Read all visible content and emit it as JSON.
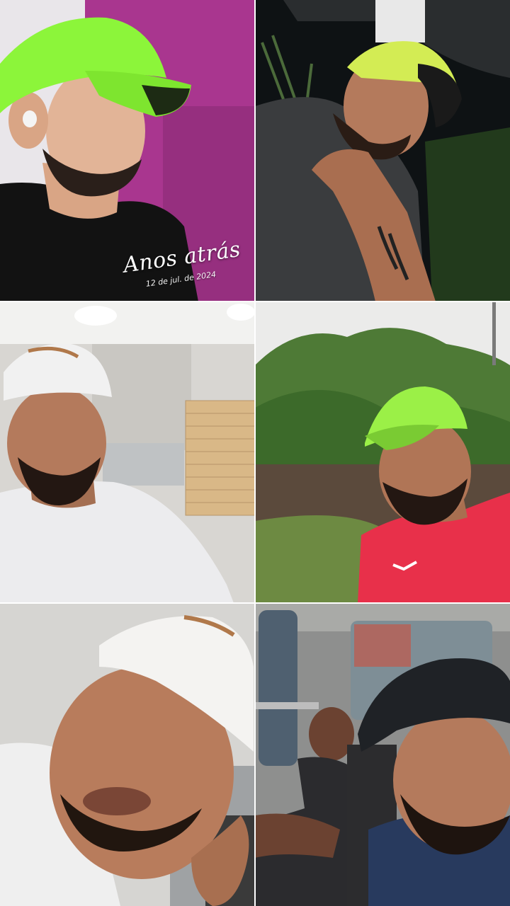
{
  "memory_overlay": {
    "title": "Anos atrás",
    "date": "12 de jul. de 2024"
  },
  "tiles": [
    {
      "id": "photo-1",
      "subject": "man-green-cap-black-shirt-pink-wall"
    },
    {
      "id": "photo-2",
      "subject": "man-yellow-cap-hand-on-chin-night"
    },
    {
      "id": "photo-3",
      "subject": "man-white-cap-white-shirt-pizzeria"
    },
    {
      "id": "photo-4",
      "subject": "man-green-cap-red-shirt-outdoors"
    },
    {
      "id": "photo-5",
      "subject": "man-white-cap-closeup"
    },
    {
      "id": "photo-6",
      "subject": "man-black-cap-in-van"
    }
  ],
  "colors": {
    "neon_green": "#8CF53A",
    "pink_wall": "#A9368F",
    "red_shirt": "#E8304A"
  }
}
